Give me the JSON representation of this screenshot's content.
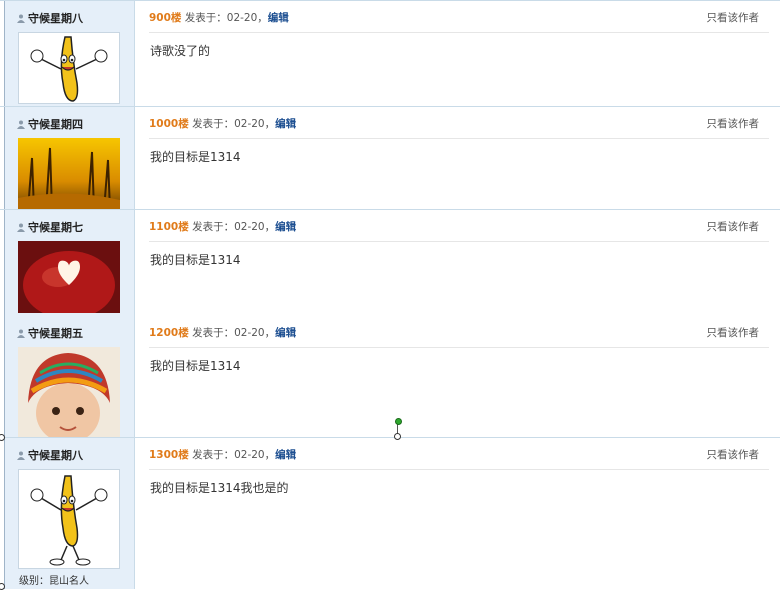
{
  "posts": [
    {
      "username": "守候星期八",
      "floor": "900楼",
      "posted_prefix": "发表于：",
      "date": "02-20",
      "sep": "，",
      "edit": "编辑",
      "only_author": "只看该作者",
      "content": "诗歌没了的",
      "avatar": "banana-dancing"
    },
    {
      "username": "守候星期四",
      "floor": "1000楼",
      "posted_prefix": "发表于：",
      "date": "02-20",
      "sep": "，",
      "edit": "编辑",
      "only_author": "只看该作者",
      "content": "我的目标是1314",
      "avatar": "autumn-trees"
    },
    {
      "username": "守候星期七",
      "floor": "1100楼",
      "posted_prefix": "发表于：",
      "date": "02-20",
      "sep": "，",
      "edit": "编辑",
      "only_author": "只看该作者",
      "content": "我的目标是1314",
      "avatar": "apple-heart"
    },
    {
      "username": "守候星期五",
      "floor": "1200楼",
      "posted_prefix": "发表于：",
      "date": "02-20",
      "sep": "，",
      "edit": "编辑",
      "only_author": "只看该作者",
      "content": "我的目标是1314",
      "avatar": "child-hat"
    },
    {
      "username": "守候星期八",
      "floor": "1300楼",
      "posted_prefix": "发表于：",
      "date": "02-20",
      "sep": "，",
      "edit": "编辑",
      "only_author": "只看该作者",
      "content": "我的目标是1314我也是的",
      "avatar": "banana-dancing",
      "level": "级别：昆山名人"
    }
  ],
  "colors": {
    "floor": "#e07b1a",
    "edit": "#1d4f91",
    "sidebar": "#e5eff9"
  }
}
